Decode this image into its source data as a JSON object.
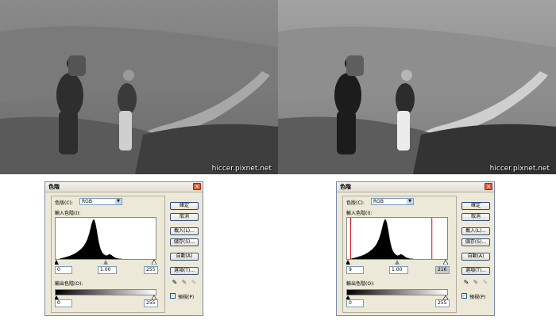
{
  "watermark": "hiccer.pixnet.net",
  "dialogs": [
    {
      "title": "色階",
      "channel_label": "色版(C):",
      "channel_value": "RGB",
      "input_label": "輸入色階(I):",
      "input_black": "0",
      "input_gamma": "1.00",
      "input_white": "255",
      "output_label": "輸出色階(O):",
      "output_black": "0",
      "output_white": "255",
      "buttons": {
        "ok": "確定",
        "cancel": "取消",
        "load": "載入(L)...",
        "save": "儲存(S)...",
        "auto": "自動(A)",
        "options": "選項(T)..."
      },
      "preview_label": "預視(P)",
      "preview_checked": true,
      "black_marker": null,
      "white_marker": null
    },
    {
      "title": "色階",
      "channel_label": "色版(C):",
      "channel_value": "RGB",
      "input_label": "輸入色階(I):",
      "input_black": "9",
      "input_gamma": "1.00",
      "input_white": "216",
      "output_label": "輸出色階(O):",
      "output_black": "0",
      "output_white": "255",
      "buttons": {
        "ok": "確定",
        "cancel": "取消",
        "load": "載入(L)...",
        "save": "儲存(S)...",
        "auto": "自動(A)",
        "options": "選項(T)..."
      },
      "preview_label": "預視(P)",
      "preview_checked": true,
      "black_marker": 9,
      "white_marker": 216
    }
  ],
  "histogram": [
    0,
    0,
    0,
    0,
    0,
    0,
    0,
    0,
    0,
    0,
    1,
    1,
    1,
    2,
    2,
    2,
    2,
    3,
    3,
    3,
    3,
    4,
    4,
    4,
    4,
    5,
    5,
    5,
    6,
    6,
    6,
    7,
    7,
    7,
    7,
    8,
    8,
    8,
    9,
    9,
    10,
    10,
    10,
    11,
    11,
    12,
    12,
    13,
    13,
    14,
    14,
    15,
    15,
    16,
    17,
    17,
    18,
    19,
    19,
    20,
    21,
    22,
    22,
    23,
    24,
    25,
    26,
    27,
    28,
    29,
    30,
    31,
    32,
    34,
    35,
    37,
    38,
    40,
    42,
    44,
    46,
    48,
    50,
    53,
    56,
    59,
    62,
    65,
    69,
    73,
    77,
    81,
    85,
    89,
    92,
    95,
    97,
    99,
    100,
    100,
    99,
    97,
    94,
    90,
    86,
    81,
    76,
    70,
    64,
    58,
    52,
    47,
    42,
    38,
    34,
    30,
    27,
    24,
    22,
    20,
    18,
    16,
    15,
    14,
    13,
    12,
    11,
    11,
    10,
    10,
    9,
    9,
    9,
    9,
    10,
    10,
    11,
    11,
    12,
    12,
    12,
    12,
    11,
    11,
    10,
    10,
    9,
    8,
    7,
    7,
    6,
    5,
    5,
    4,
    4,
    3,
    3,
    3,
    2,
    2,
    2,
    2,
    1,
    1,
    1,
    1,
    1,
    1,
    1,
    1,
    1,
    0,
    0,
    0,
    0,
    0,
    0,
    0,
    0,
    0,
    0,
    0,
    0,
    0,
    0,
    0,
    0,
    0,
    0,
    0,
    0,
    0,
    0,
    0,
    0,
    0,
    0,
    0,
    0,
    0,
    0,
    0,
    0,
    0,
    0,
    0,
    0,
    0,
    0,
    0,
    0,
    0,
    0,
    0,
    0,
    0,
    0,
    0,
    0,
    0,
    0,
    0,
    0,
    0,
    0,
    0,
    0,
    0,
    0,
    0,
    0,
    0,
    0,
    0,
    0,
    0,
    0,
    0,
    0,
    0,
    0,
    0,
    0,
    0,
    0,
    0,
    0,
    0,
    0,
    0,
    0,
    0,
    0,
    0,
    0,
    0,
    0,
    0,
    0,
    0
  ]
}
